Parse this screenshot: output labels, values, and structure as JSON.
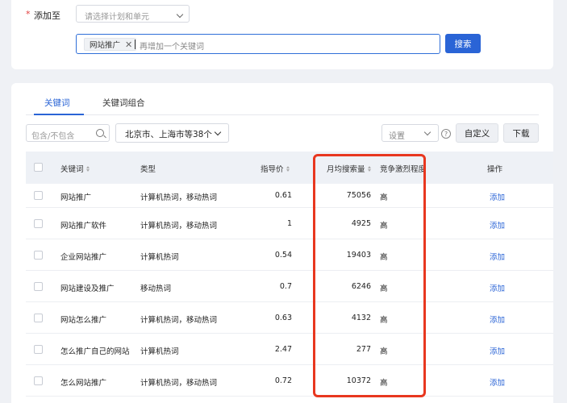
{
  "add_to": {
    "required_mark": "*",
    "label": "添加至",
    "plan_placeholder": "请选择计划和单元"
  },
  "keyword_input": {
    "tag": "网站推广",
    "placeholder": "再增加一个关键词",
    "search_label": "搜索"
  },
  "tabs": [
    {
      "label": "关键词",
      "active": true
    },
    {
      "label": "关键词组合",
      "active": false
    }
  ],
  "filters": {
    "include_placeholder": "包含/不包含",
    "region_value": "北京市、上海市等38个",
    "settings_placeholder": "设置",
    "customize_label": "自定义",
    "download_label": "下载"
  },
  "table": {
    "headers": {
      "keyword": "关键词",
      "type": "类型",
      "price": "指导价",
      "volume": "月均搜索量",
      "competition": "竞争激烈程度",
      "action": "操作"
    },
    "rows": [
      {
        "keyword": "网站推广",
        "type": "计算机热词，移动热词",
        "price": "0.61",
        "volume": "75056",
        "competition": "高",
        "action": "添加"
      },
      {
        "keyword": "网站推广软件",
        "type": "计算机热词，移动热词",
        "price": "1",
        "volume": "4925",
        "competition": "高",
        "action": "添加"
      },
      {
        "keyword": "企业网站推广",
        "type": "计算机热词",
        "price": "0.54",
        "volume": "19403",
        "competition": "高",
        "action": "添加"
      },
      {
        "keyword": "网站建设及推广",
        "type": "移动热词",
        "price": "0.7",
        "volume": "6246",
        "competition": "高",
        "action": "添加"
      },
      {
        "keyword": "网站怎么推广",
        "type": "计算机热词，移动热词",
        "price": "0.63",
        "volume": "4132",
        "competition": "高",
        "action": "添加"
      },
      {
        "keyword": "怎么推广自己的网站",
        "type": "计算机热词",
        "price": "2.47",
        "volume": "277",
        "competition": "高",
        "action": "添加"
      },
      {
        "keyword": "怎么网站推广",
        "type": "计算机热词，移动热词",
        "price": "0.72",
        "volume": "10372",
        "competition": "高",
        "action": "添加"
      }
    ]
  },
  "colors": {
    "accent": "#2a64d6",
    "highlight_border": "#e8371f",
    "required": "#e23c3c"
  }
}
